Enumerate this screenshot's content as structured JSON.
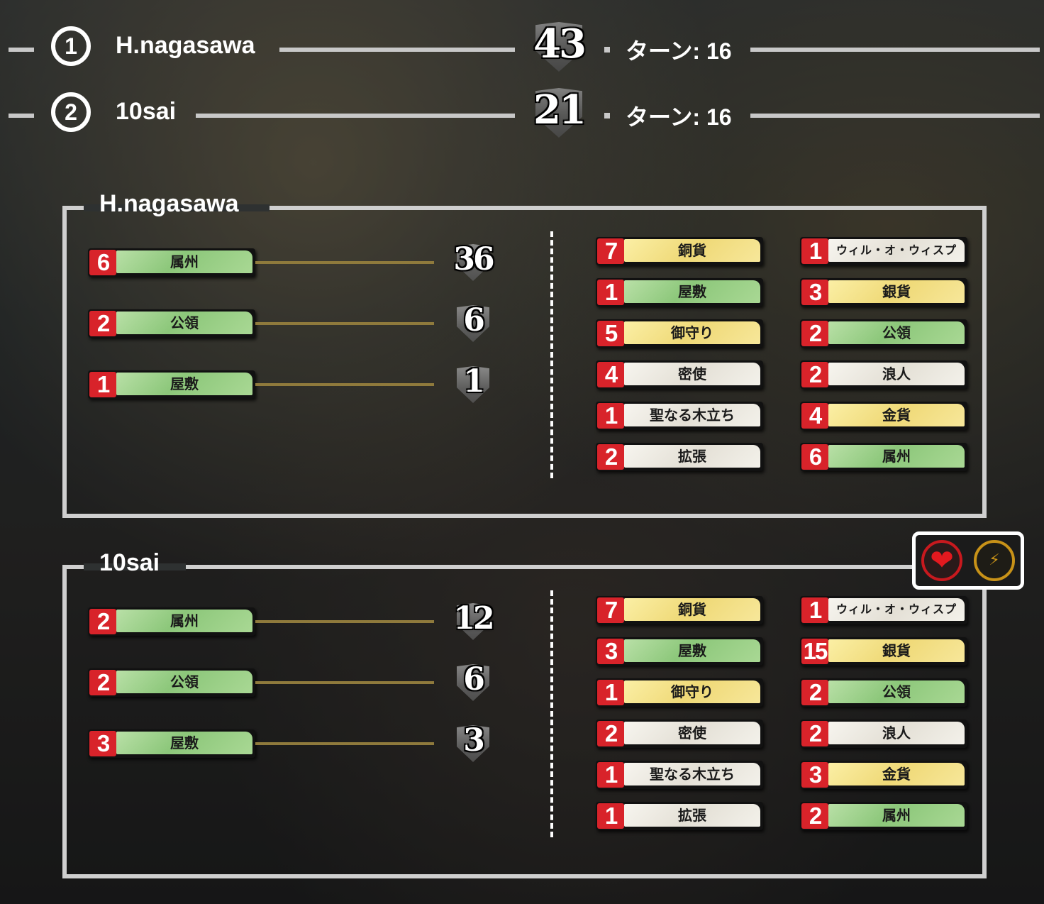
{
  "ranking": [
    {
      "rank": "1",
      "name": "H.nagasawa",
      "score": "43",
      "turn": "ターン: 16"
    },
    {
      "rank": "2",
      "name": "10sai",
      "score": "21",
      "turn": "ターン: 16"
    }
  ],
  "players": [
    {
      "name": "H.nagasawa",
      "vp_cards": [
        {
          "count": "6",
          "label": "属州",
          "color": "green",
          "vp": "36"
        },
        {
          "count": "2",
          "label": "公領",
          "color": "green",
          "vp": "6"
        },
        {
          "count": "1",
          "label": "屋敷",
          "color": "green",
          "vp": "1"
        }
      ],
      "deck_left": [
        {
          "count": "7",
          "label": "銅貨",
          "color": "yellow"
        },
        {
          "count": "1",
          "label": "屋敷",
          "color": "green"
        },
        {
          "count": "5",
          "label": "御守り",
          "color": "yellow"
        },
        {
          "count": "4",
          "label": "密使",
          "color": "white"
        },
        {
          "count": "1",
          "label": "聖なる木立ち",
          "color": "white"
        },
        {
          "count": "2",
          "label": "拡張",
          "color": "white"
        }
      ],
      "deck_right": [
        {
          "count": "1",
          "label": "ウィル・オ・ウィスプ",
          "color": "white"
        },
        {
          "count": "3",
          "label": "銀貨",
          "color": "yellow"
        },
        {
          "count": "2",
          "label": "公領",
          "color": "green"
        },
        {
          "count": "2",
          "label": "浪人",
          "color": "white"
        },
        {
          "count": "4",
          "label": "金貨",
          "color": "yellow"
        },
        {
          "count": "6",
          "label": "属州",
          "color": "green"
        }
      ]
    },
    {
      "name": "10sai",
      "vp_cards": [
        {
          "count": "2",
          "label": "属州",
          "color": "green",
          "vp": "12"
        },
        {
          "count": "2",
          "label": "公領",
          "color": "green",
          "vp": "6"
        },
        {
          "count": "3",
          "label": "屋敷",
          "color": "green",
          "vp": "3"
        }
      ],
      "deck_left": [
        {
          "count": "7",
          "label": "銅貨",
          "color": "yellow"
        },
        {
          "count": "3",
          "label": "屋敷",
          "color": "green"
        },
        {
          "count": "1",
          "label": "御守り",
          "color": "yellow"
        },
        {
          "count": "2",
          "label": "密使",
          "color": "white"
        },
        {
          "count": "1",
          "label": "聖なる木立ち",
          "color": "white"
        },
        {
          "count": "1",
          "label": "拡張",
          "color": "white"
        }
      ],
      "deck_right": [
        {
          "count": "1",
          "label": "ウィル・オ・ウィスプ",
          "color": "white"
        },
        {
          "count": "15",
          "label": "銀貨",
          "color": "yellow"
        },
        {
          "count": "2",
          "label": "公領",
          "color": "green"
        },
        {
          "count": "2",
          "label": "浪人",
          "color": "white"
        },
        {
          "count": "3",
          "label": "金貨",
          "color": "yellow"
        },
        {
          "count": "2",
          "label": "属州",
          "color": "green"
        }
      ]
    }
  ],
  "reactions": [
    {
      "icon": "heart-icon",
      "color": "#e3191f"
    },
    {
      "icon": "lightning-icon",
      "color": "#c89218"
    }
  ]
}
